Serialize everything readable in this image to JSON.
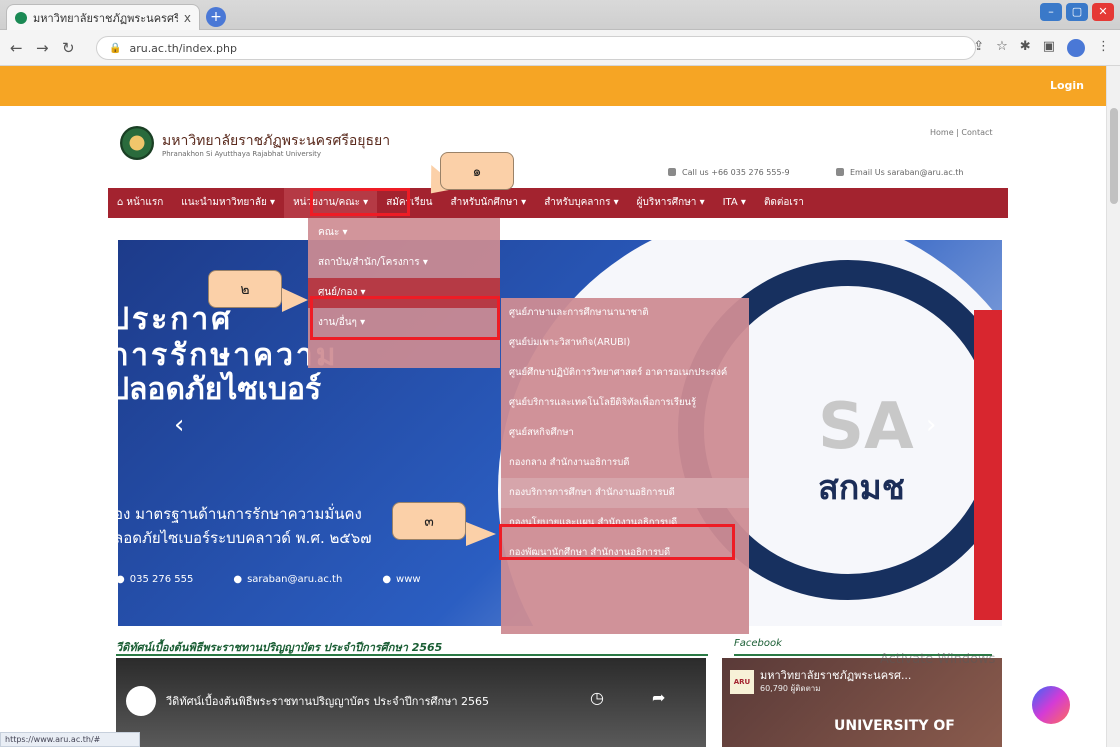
{
  "browser": {
    "tab_title": "มหาวิทยาลัยราชภัฏพระนครศรีอยุธยา",
    "tab_close": "x",
    "new_tab": "+",
    "url": "aru.ac.th/index.php",
    "win_min": "–",
    "win_max": "▢",
    "win_close": "✕",
    "status_url": "https://www.aru.ac.th/#"
  },
  "topbar": {
    "login": "Login"
  },
  "header": {
    "university_th": "มหาวิทยาลัยราชภัฏพระนครศรีอยุธยา",
    "university_en": "Phranakhon Si Ayutthaya Rajabhat University",
    "top_links": "Home | Contact",
    "call_us": "Call us +66 035 276 555-9",
    "email": "Email Us saraban@aru.ac.th"
  },
  "nav": {
    "items": [
      {
        "label": "หน้าแรก"
      },
      {
        "label": "แนะนำมหาวิทยาลัย ▾"
      },
      {
        "label": "หน่วยงาน/คณะ ▾"
      },
      {
        "label": "สมัครเรียน"
      },
      {
        "label": "สำหรับนักศึกษา ▾"
      },
      {
        "label": "สำหรับบุคลากร ▾"
      },
      {
        "label": "ผู้บริหารศึกษา ▾"
      },
      {
        "label": "ITA ▾"
      },
      {
        "label": "ติดต่อเรา"
      }
    ]
  },
  "dropdown1": {
    "items": [
      {
        "label": "คณะ ▾"
      },
      {
        "label": "สถาบัน/สำนัก/โครงการ ▾"
      },
      {
        "label": "ศูนย์/กอง ▾"
      },
      {
        "label": "งาน/อื่นๆ ▾"
      }
    ]
  },
  "dropdown2": {
    "items": [
      {
        "label": "ศูนย์ภาษาและการศึกษานานาชาติ"
      },
      {
        "label": "ศูนย์บ่มเพาะวิสาหกิจ(ARUBI)"
      },
      {
        "label": "ศูนย์ศึกษาปฏิบัติการวิทยาศาสตร์ อาคารอเนกประสงค์"
      },
      {
        "label": "ศูนย์บริการและเทคโนโลยีดิจิทัลเพื่อการเรียนรู้"
      },
      {
        "label": "ศูนย์สหกิจศึกษา"
      },
      {
        "label": "กองกลาง สำนักงานอธิการบดี"
      },
      {
        "label": "กองบริการการศึกษา สำนักงานอธิการบดี"
      },
      {
        "label": "กองนโยบายและแผน สำนักงานอธิการบดี"
      },
      {
        "label": "กองพัฒนานักศึกษา สำนักงานอธิการบดี"
      }
    ]
  },
  "annotations": {
    "step1": "๑",
    "step2": "๒",
    "step3": "๓"
  },
  "hero": {
    "line1": "ประกาศ",
    "line2": "การรักษาความ",
    "line3": "ปลอดภัยไซเบอร์",
    "sub1": "อง มาตรฐานด้านการรักษาความมั่นคง",
    "sub2": "ลอดภัยไซเบอร์ระบบคลาวด์ พ.ศ. ๒๕๖๗",
    "phone": "035 276 555",
    "email": "saraban@aru.ac.th",
    "web": "www",
    "logo_sa": "SA",
    "logo_th": "สกมช"
  },
  "video": {
    "section_title": "วีดิทัศน์เบื้องต้นพิธีพระราชทานปริญญาบัตร ประจำปีการศึกษา 2565",
    "caption": "วีดิทัศน์เบื้องต้นพิธีพระราชทานปริญญาบัตร ประจำปีการศึกษา 2565"
  },
  "facebook": {
    "section_title": "Facebook",
    "logo": "ARU",
    "page_name": "มหาวิทยาลัยราชภัฏพระนครศ...",
    "likes": "60,790 ผู้ติดตาม",
    "banner": "UNIVERSITY OF"
  },
  "watermark": {
    "activate": "Activate Windows"
  }
}
